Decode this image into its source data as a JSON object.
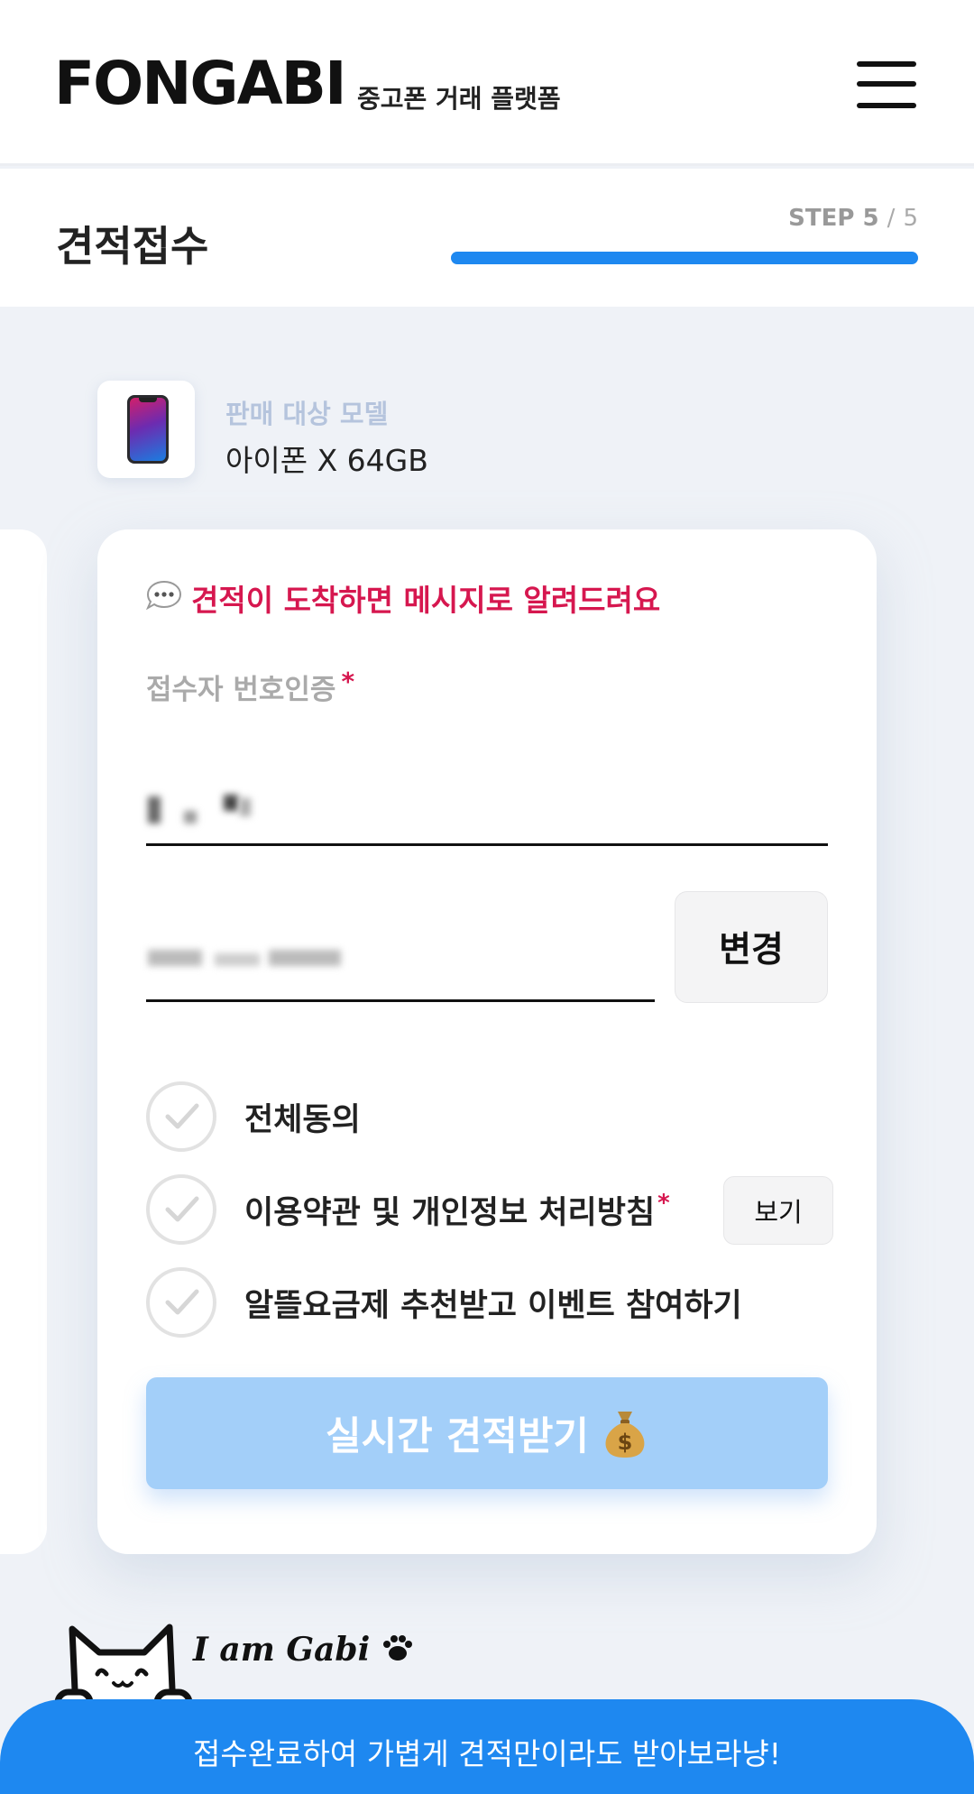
{
  "header": {
    "logo": "FONGABI",
    "tagline": "중고폰 거래 플랫폼",
    "menu_icon": "hamburger-menu-icon"
  },
  "step": {
    "title": "견적접수",
    "label": "STEP 5",
    "separator": "/",
    "total": "5",
    "progress": 1.0
  },
  "model": {
    "label": "판매 대상 모델",
    "name": "아이폰 X 64GB",
    "thumbnail_icon": "iphone-x-icon"
  },
  "form": {
    "notice_icon": "speech-bubble-icon",
    "notice": "견적이 도착하면 메시지로 알려드려요",
    "phone_label": "접수자 번호인증",
    "required_mark": "*",
    "change_button": "변경",
    "agreements": [
      {
        "label": "전체동의",
        "required": false
      },
      {
        "label": "이용약관 및 개인정보 처리방침",
        "required": true,
        "button": "보기"
      },
      {
        "label": "알뜰요금제 추천받고 이벤트 참여하기",
        "required": false
      }
    ],
    "submit_label": "실시간 견적받기",
    "submit_icon": "money-bag-icon"
  },
  "footer": {
    "mascot_text": "I am Gabi",
    "banner": "접수완료하여 가볍게 견적만이라도 받아보라냥!"
  },
  "colors": {
    "brand_blue": "#1e88f0",
    "accent_red": "#d6174f",
    "submit_disabled": "#a3cff9",
    "background": "#eff2f7"
  }
}
